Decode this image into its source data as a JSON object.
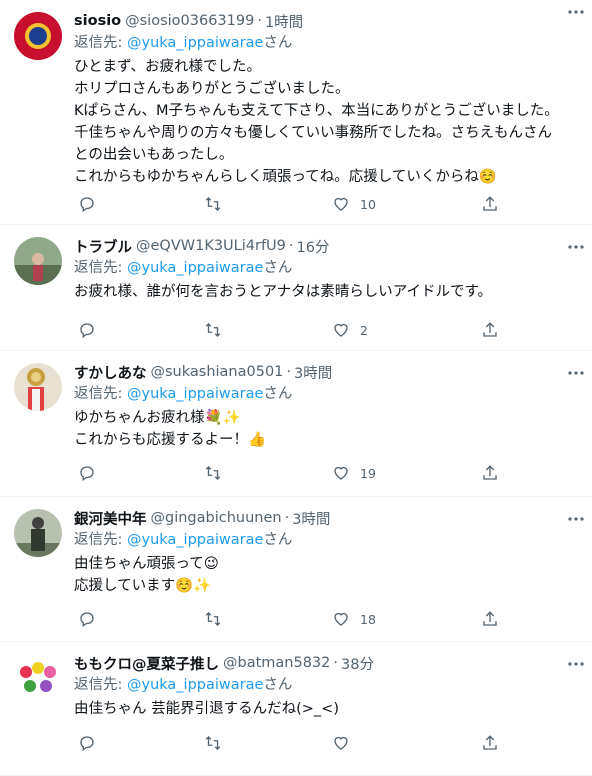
{
  "tweets": [
    {
      "name": "siosio",
      "handle": "@siosio03663199",
      "time": "1時間",
      "reply_label": "返信先:",
      "reply_to": "@yuka_ippaiwarae",
      "reply_suffix": "さん",
      "text": "ひとまず、お疲れ様でした。\nホリプロさんもありがとうございました。\nKぱらさん、M子ちゃんも支えて下さり、本当にありがとうございました。\n千佳ちゃんや周りの方々も優しくていい事務所でしたね。さちえもんさん\nとの出会いもあったし。\nこれからもゆかちゃんらしく頑張ってね。応援していくからね☺️",
      "likes": "10",
      "avatar_color": "#c8102e"
    },
    {
      "name": "トラブル",
      "handle": "@eQVW1K3ULi4rfU9",
      "time": "16分",
      "reply_label": "返信先:",
      "reply_to": "@yuka_ippaiwarae",
      "reply_suffix": "さん",
      "text": "お疲れ様、誰が何を言おうとアナタは素晴らしいアイドルです。",
      "likes": "2",
      "avatar_color": "#6b8e6b"
    },
    {
      "name": "すかしあな",
      "handle": "@sukashiana0501",
      "time": "3時間",
      "reply_label": "返信先:",
      "reply_to": "@yuka_ippaiwarae",
      "reply_suffix": "さん",
      "text": "ゆかちゃんお疲れ様💐✨\nこれからも応援するよー！👍",
      "likes": "19",
      "avatar_color": "#d9c9a8"
    },
    {
      "name": "銀河美中年",
      "handle": "@gingabichuunen",
      "time": "3時間",
      "reply_label": "返信先:",
      "reply_to": "@yuka_ippaiwarae",
      "reply_suffix": "さん",
      "text": "由佳ちゃん頑張って😉\n応援しています☺️✨",
      "likes": "18",
      "avatar_color": "#7a8a70"
    },
    {
      "name": "ももクロ@夏菜子推し",
      "handle": "@batman5832",
      "time": "38分",
      "reply_label": "返信先:",
      "reply_to": "@yuka_ippaiwarae",
      "reply_suffix": "さん",
      "text": "由佳ちゃん 芸能界引退するんだね(>_<)",
      "likes": "",
      "avatar_color": "#e85a8a"
    }
  ]
}
